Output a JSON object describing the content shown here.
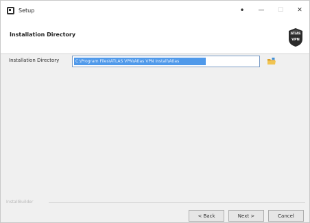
{
  "window": {
    "title": "Setup",
    "controls": {
      "help": "•",
      "minimize": "—",
      "maximize": "☐",
      "close": "✕"
    }
  },
  "header": {
    "title": "Installation Directory",
    "logo_text_top": "ATLAS",
    "logo_text_bottom": "VPN"
  },
  "form": {
    "label": "Installation Directory",
    "value": "C:\\Program Files\\ATLAS VPN\\Atlas VPN Install\\Atlas"
  },
  "footer": {
    "brand": "InstallBuilder"
  },
  "buttons": {
    "back": "< Back",
    "next": "Next >",
    "cancel": "Cancel"
  },
  "colors": {
    "selection": "#3d8ee8",
    "input_border": "#7a9cc6",
    "folder_icon": "#e7b43c"
  }
}
